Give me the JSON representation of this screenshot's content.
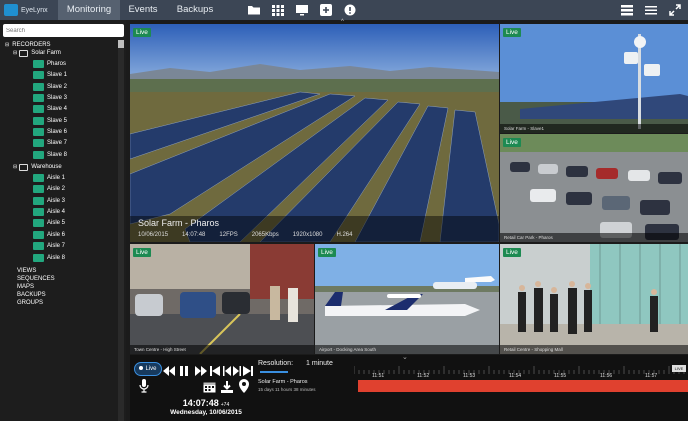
{
  "app": {
    "logo_text": "EyeLynx"
  },
  "nav": {
    "tabs": [
      {
        "label": "Monitoring",
        "active": true
      },
      {
        "label": "Events",
        "active": false
      },
      {
        "label": "Backups",
        "active": false
      }
    ],
    "icons": [
      "folder-icon",
      "grid-icon",
      "monitor-icon",
      "plus-icon",
      "alert-icon"
    ],
    "right_icons": [
      "layout-icon",
      "menu-icon",
      "fullscreen-icon"
    ]
  },
  "sidebar": {
    "search_placeholder": "Search",
    "recorders_label": "RECORDERS",
    "groups": [
      {
        "name": "Solar Farm",
        "cameras": [
          "Pharos",
          "Slave 1",
          "Slave 2",
          "Slave 3",
          "Slave 4",
          "Slave 5",
          "Slave 6",
          "Slave 7",
          "Slave 8"
        ]
      },
      {
        "name": "Warehouse",
        "cameras": [
          "Aisle 1",
          "Aisle 2",
          "Aisle 3",
          "Aisle 4",
          "Aisle 5",
          "Aisle 6",
          "Aisle 7",
          "Aisle 8"
        ]
      }
    ],
    "sections": [
      "VIEWS",
      "SEQUENCES",
      "MAPS",
      "BACKUPS",
      "GROUPS"
    ]
  },
  "tiles": {
    "live_label": "Live",
    "main": {
      "title": "Solar Farm - Pharos",
      "date": "10/06/2015",
      "time": "14:07:48",
      "fps": "12FPS",
      "bitrate": "2065Kbps",
      "resolution": "1920x1080",
      "codec": "H.264"
    },
    "captions": [
      "Solar Farm - Slave1",
      "Retail Car Park - Pharos",
      "Town Centre - High Street",
      "Airport - Docking Area South",
      "Retail Centre - Shopping Mall"
    ]
  },
  "controls": {
    "live_label": "Live",
    "time": "14:07:48",
    "time_offset": "+74",
    "date": "Wednesday, 10/06/2015"
  },
  "timeline": {
    "resolution_label": "Resolution:",
    "resolution_value": "1 minute",
    "ticks": [
      "11:51",
      "11:52",
      "11:53",
      "11:54",
      "11:55",
      "11:56",
      "11:57"
    ],
    "track_name": "Solar Farm - Pharos",
    "track_info": "15 days 11 hours 38 minutes",
    "now_marker": "LIVE",
    "colors": {
      "recording": "#e0412f",
      "accent": "#3a8fe0"
    }
  }
}
